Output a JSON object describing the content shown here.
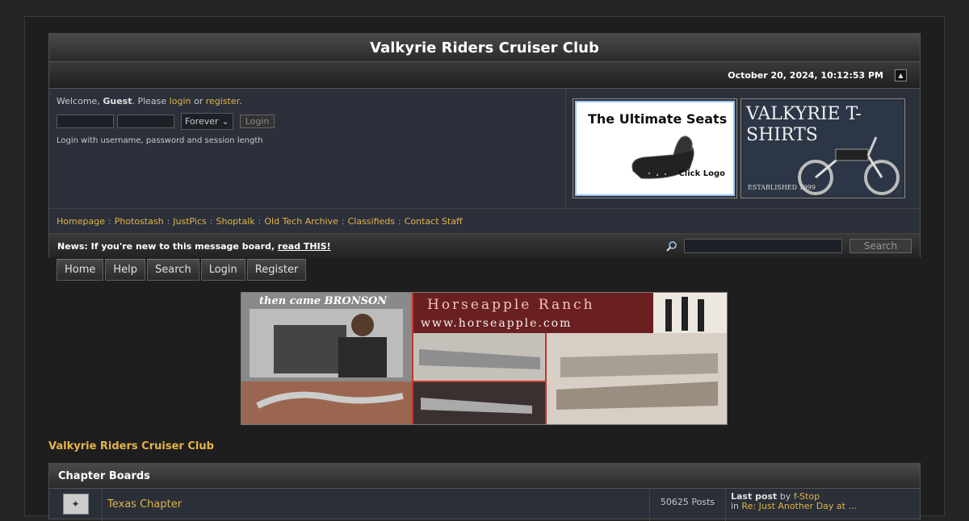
{
  "forum": {
    "title": "Valkyrie Riders Cruiser Club",
    "datetime": "October 20, 2024, 10:12:53 PM"
  },
  "user_panel": {
    "welcome": "Welcome,",
    "guest": "Guest",
    "please": ". Please",
    "login_link": "login",
    "or": "or",
    "register_link": "register",
    "period": ".",
    "session_length": "Forever",
    "login_button": "Login",
    "hint": "Login with username, password and session length"
  },
  "ads": {
    "seats_text": "The Ultimate Seats",
    "seats_click": "Click Logo",
    "shirts_text": "VALKYRIE T-SHIRTS",
    "shirts_est": "ESTABLISHED 1999"
  },
  "quick_links": [
    {
      "label": "Homepage"
    },
    {
      "label": "Photostash"
    },
    {
      "label": "JustPics"
    },
    {
      "label": "Shoptalk"
    },
    {
      "label": "Old Tech Archive"
    },
    {
      "label": "Classifieds"
    },
    {
      "label": "Contact Staff"
    }
  ],
  "news": {
    "prefix": "News: If you're new to this message board,",
    "link": "read THIS!",
    "search_button": "Search"
  },
  "tabs": [
    {
      "label": "Home"
    },
    {
      "label": "Help"
    },
    {
      "label": "Search"
    },
    {
      "label": "Login"
    },
    {
      "label": "Register"
    }
  ],
  "banner": {
    "left_caption": "then came BRONSON",
    "right_caption": "Horseapple Ranch",
    "url": "www.horseapple.com"
  },
  "breadcrumb": "Valkyrie Riders Cruiser Club",
  "category": {
    "title": "Chapter Boards",
    "boards": [
      {
        "name": "Texas Chapter",
        "posts": "50625 Posts",
        "last_post_label": "Last post",
        "by": "by",
        "last_user": "f-Stop",
        "in": "in",
        "last_topic": "Re: Just Another Day at ..."
      }
    ]
  },
  "colors": {
    "link": "#e3b44a",
    "panel_bg": "#2b303a",
    "page_bg": "#252525"
  }
}
